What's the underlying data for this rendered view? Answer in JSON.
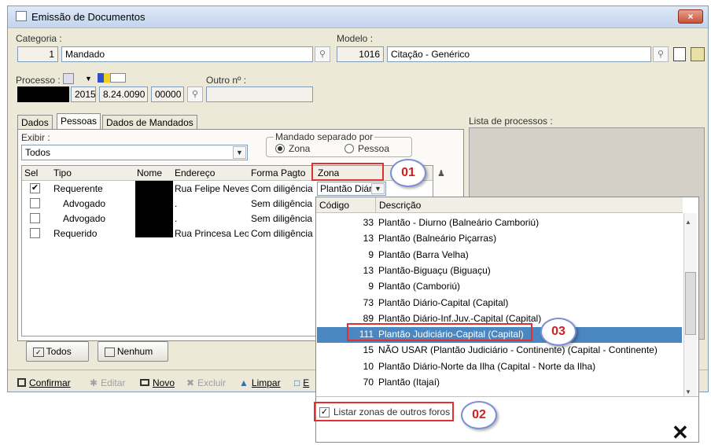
{
  "window": {
    "title": "Emissão de Documentos",
    "close": "×"
  },
  "categoria": {
    "label": "Categoria :",
    "code": "1",
    "name": "Mandado"
  },
  "modelo": {
    "label": "Modelo :",
    "code": "1016",
    "name": "Citação - Genérico"
  },
  "processo": {
    "label": "Processo :",
    "year": "2015",
    "number": "8.24.0090",
    "suffix": "00000",
    "outro_label": "Outro nº :"
  },
  "tabs": [
    "Dados",
    "Pessoas",
    "Dados de Mandados"
  ],
  "exibir": {
    "label": "Exibir :",
    "value": "Todos"
  },
  "mandado_separado": {
    "legend": "Mandado separado por",
    "opt_zona": "Zona",
    "opt_pessoa": "Pessoa"
  },
  "lista_processos": {
    "label": "Lista de processos :"
  },
  "grid": {
    "headers": [
      "Sel",
      "Tipo",
      "Nome",
      "Endereço",
      "Forma Pagto",
      "Zona"
    ],
    "rows": [
      {
        "sel": "✔",
        "tipo": "Requerente",
        "endereco": "Rua Felipe Neves",
        "forma": "Com diligência",
        "zona": "Plantão Diário"
      },
      {
        "sel": "",
        "tipo": "Advogado",
        "endereco": ".",
        "forma": "Sem diligência",
        "zona": ""
      },
      {
        "sel": "",
        "tipo": "Advogado",
        "endereco": ".",
        "forma": "Sem diligência",
        "zona": ""
      },
      {
        "sel": "",
        "tipo": "Requerido",
        "endereco": "Rua Princesa Leopoldina",
        "forma": "Com diligência",
        "zona": ""
      }
    ]
  },
  "dropdown": {
    "headers": [
      "Código",
      "Descrição"
    ],
    "rows": [
      {
        "code": "33",
        "desc": "Plantão - Diurno (Balneário Camboriú)"
      },
      {
        "code": "13",
        "desc": "Plantão (Balneário Piçarras)"
      },
      {
        "code": "9",
        "desc": "Plantão (Barra Velha)"
      },
      {
        "code": "13",
        "desc": "Plantão-Biguaçu (Biguaçu)"
      },
      {
        "code": "9",
        "desc": "Plantão (Camboriú)"
      },
      {
        "code": "73",
        "desc": "Plantão Diário-Capital (Capital)"
      },
      {
        "code": "89",
        "desc": "Plantão Diário-Inf.Juv.-Capital (Capital)"
      },
      {
        "code": "111",
        "desc": "Plantão Judiciário-Capital (Capital)"
      },
      {
        "code": "15",
        "desc": "NÃO USAR (Plantão Judiciário - Continente) (Capital - Continente)"
      },
      {
        "code": "10",
        "desc": "Plantão Diário-Norte da Ilha (Capital - Norte da Ilha)"
      },
      {
        "code": "70",
        "desc": "Plantão (Itajaí)"
      }
    ],
    "checkbox_label": "Listar zonas de outros foros",
    "close": "✕"
  },
  "buttons": {
    "todos": "Todos",
    "nenhum": "Nenhum"
  },
  "toolbar": {
    "confirmar": "Confirmar",
    "editar": "Editar",
    "novo": "Novo",
    "excluir": "Excluir",
    "limpar": "Limpar",
    "e": "E"
  },
  "callouts": {
    "c1": "01",
    "c2": "02",
    "c3": "03"
  },
  "colors": {
    "selection": "#4a86c0",
    "callout": "#e03030",
    "window_bg": "#ece9d8"
  }
}
